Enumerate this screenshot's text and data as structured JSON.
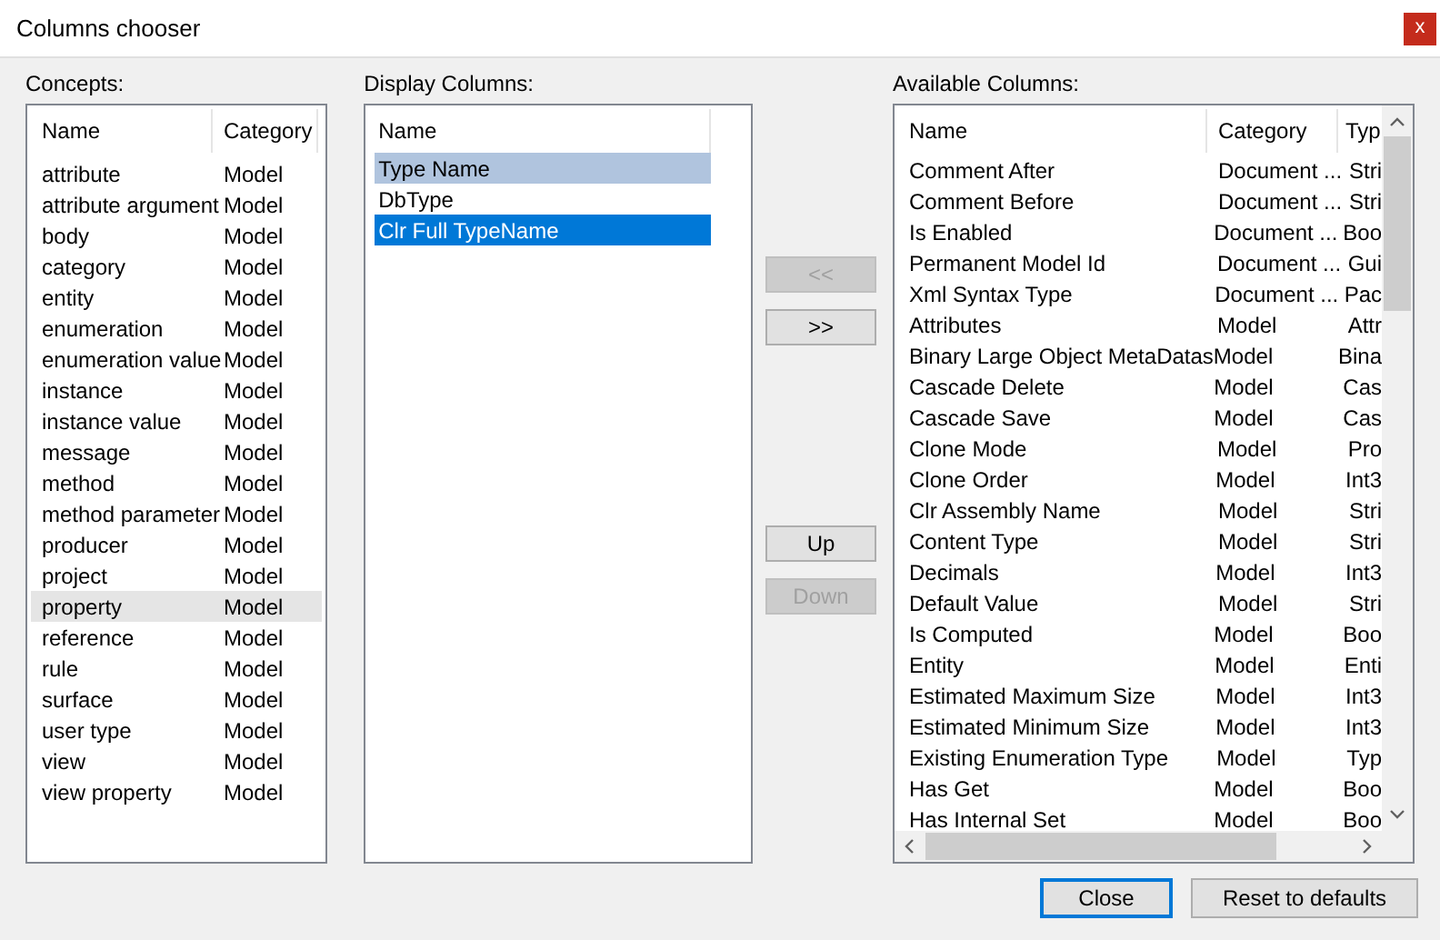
{
  "window": {
    "title": "Columns chooser",
    "close": "x"
  },
  "concepts": {
    "label": "Concepts:",
    "columns": [
      "Name",
      "Category"
    ],
    "rows": [
      {
        "cells": [
          "attribute",
          "Model"
        ],
        "selected": false
      },
      {
        "cells": [
          "attribute argument",
          "Model"
        ],
        "selected": false
      },
      {
        "cells": [
          "body",
          "Model"
        ],
        "selected": false
      },
      {
        "cells": [
          "category",
          "Model"
        ],
        "selected": false
      },
      {
        "cells": [
          "entity",
          "Model"
        ],
        "selected": false
      },
      {
        "cells": [
          "enumeration",
          "Model"
        ],
        "selected": false
      },
      {
        "cells": [
          "enumeration value",
          "Model"
        ],
        "selected": false
      },
      {
        "cells": [
          "instance",
          "Model"
        ],
        "selected": false
      },
      {
        "cells": [
          "instance value",
          "Model"
        ],
        "selected": false
      },
      {
        "cells": [
          "message",
          "Model"
        ],
        "selected": false
      },
      {
        "cells": [
          "method",
          "Model"
        ],
        "selected": false
      },
      {
        "cells": [
          "method parameter",
          "Model"
        ],
        "selected": false
      },
      {
        "cells": [
          "producer",
          "Model"
        ],
        "selected": false
      },
      {
        "cells": [
          "project",
          "Model"
        ],
        "selected": false
      },
      {
        "cells": [
          "property",
          "Model"
        ],
        "selected": true
      },
      {
        "cells": [
          "reference",
          "Model"
        ],
        "selected": false
      },
      {
        "cells": [
          "rule",
          "Model"
        ],
        "selected": false
      },
      {
        "cells": [
          "surface",
          "Model"
        ],
        "selected": false
      },
      {
        "cells": [
          "user type",
          "Model"
        ],
        "selected": false
      },
      {
        "cells": [
          "view",
          "Model"
        ],
        "selected": false
      },
      {
        "cells": [
          "view property",
          "Model"
        ],
        "selected": false
      }
    ]
  },
  "display_columns": {
    "label": "Display Columns:",
    "columns": [
      "Name"
    ],
    "rows": [
      {
        "name": "Type Name",
        "selected": true,
        "focused": false
      },
      {
        "name": "DbType",
        "selected": false,
        "focused": false
      },
      {
        "name": "Clr Full TypeName",
        "selected": true,
        "focused": true
      }
    ]
  },
  "move_buttons": [
    {
      "label": "<<",
      "disabled": true
    },
    {
      "label": ">>",
      "disabled": false
    }
  ],
  "order_buttons": [
    {
      "label": "Up",
      "disabled": false
    },
    {
      "label": "Down",
      "disabled": true
    }
  ],
  "available_columns": {
    "label": "Available Columns:",
    "columns": [
      "Name",
      "Category",
      "Typ"
    ],
    "rows": [
      [
        "Comment After",
        "Document ...",
        "Stri"
      ],
      [
        "Comment Before",
        "Document ...",
        "Stri"
      ],
      [
        "Is Enabled",
        "Document ...",
        "Boo"
      ],
      [
        "Permanent Model Id",
        "Document ...",
        "Gui"
      ],
      [
        "Xml Syntax Type",
        "Document ...",
        "Pac"
      ],
      [
        "Attributes",
        "Model",
        "Attr"
      ],
      [
        "Binary Large Object MetaDatas",
        "Model",
        "Bina"
      ],
      [
        "Cascade Delete",
        "Model",
        "Cas"
      ],
      [
        "Cascade Save",
        "Model",
        "Cas"
      ],
      [
        "Clone Mode",
        "Model",
        "Pro"
      ],
      [
        "Clone Order",
        "Model",
        "Int3"
      ],
      [
        "Clr Assembly Name",
        "Model",
        "Stri"
      ],
      [
        "Content Type",
        "Model",
        "Stri"
      ],
      [
        "Decimals",
        "Model",
        "Int3"
      ],
      [
        "Default Value",
        "Model",
        "Stri"
      ],
      [
        "Is Computed",
        "Model",
        "Boo"
      ],
      [
        "Entity",
        "Model",
        "Enti"
      ],
      [
        "Estimated Maximum Size",
        "Model",
        "Int3"
      ],
      [
        "Estimated Minimum Size",
        "Model",
        "Int3"
      ],
      [
        "Existing Enumeration Type",
        "Model",
        "Typ"
      ],
      [
        "Has Get",
        "Model",
        "Boo"
      ],
      [
        "Has Internal Set",
        "Model",
        "Boo"
      ]
    ]
  },
  "footer_buttons": [
    {
      "label": "Close",
      "default": true
    },
    {
      "label": "Reset to defaults",
      "default": false
    }
  ]
}
